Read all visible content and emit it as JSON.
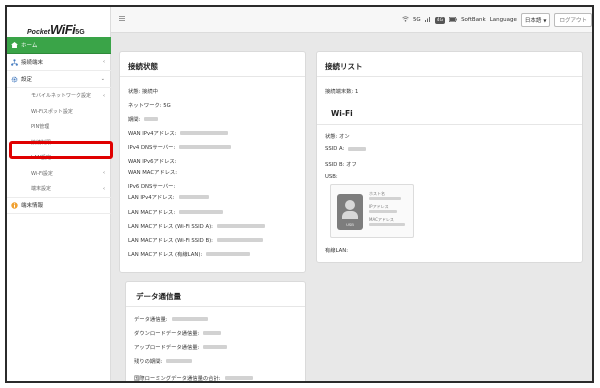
{
  "logo": {
    "pocket": "Pocket",
    "wifi": "WiFi",
    "fiveg": "5G"
  },
  "sidebar": {
    "items": [
      {
        "label": "ホーム",
        "icon": "home-icon"
      },
      {
        "label": "接続端末",
        "icon": "network-icon",
        "chevron": "‹"
      },
      {
        "label": "設定",
        "icon": "gear-icon",
        "chevron": "⌄"
      },
      {
        "label": "モバイルネットワーク設定",
        "chevron": "‹"
      },
      {
        "label": "Wi-Fiスポット設定"
      },
      {
        "label": "PIN管理"
      },
      {
        "label": "接続制限"
      },
      {
        "label": "LAN設定",
        "chevron": "‹"
      },
      {
        "label": "Wi-Fi設定",
        "chevron": "‹"
      },
      {
        "label": "端末設定",
        "chevron": "‹"
      },
      {
        "label": "端末情報",
        "icon": "info-icon"
      }
    ]
  },
  "topbar": {
    "signal": "5G",
    "network_badge": "4G",
    "carrier": "SoftBank",
    "language_label": "Language",
    "language_value": "日本語",
    "logout": "ログアウト"
  },
  "connection_status": {
    "title": "接続状態",
    "rows": [
      {
        "label": "状態: 接続中"
      },
      {
        "label": "ネットワーク: 5G"
      },
      {
        "label": "期間:"
      },
      {
        "label": "WAN IPv4アドレス:"
      },
      {
        "label": "IPv4 DNSサーバー:"
      },
      {
        "label": "WAN IPv6アドレス:"
      },
      {
        "label": "WAN MACアドレス:"
      },
      {
        "label": "IPv6 DNSサーバー:"
      },
      {
        "label": "LAN IPv4アドレス:"
      },
      {
        "label": "LAN MACアドレス:"
      },
      {
        "label": "LAN MACアドレス (Wi-Fi SSID A):"
      },
      {
        "label": "LAN MACアドレス (Wi-Fi SSID B):"
      },
      {
        "label": "LAN MACアドレス (有線LAN):"
      }
    ]
  },
  "connection_list": {
    "title": "接続リスト",
    "count": "接続端末数: 1"
  },
  "wifi": {
    "title": "Wi-Fi",
    "status": "状態: オン",
    "ssid_a": "SSID A:",
    "ssid_b": "SSID B: オフ",
    "usb": "USB:",
    "usb_icon_label": "USB",
    "device_lines": [
      "ホスト名",
      "IPアドレス",
      "MACアドレス"
    ],
    "wired_lan": "有線LAN:"
  },
  "data_usage": {
    "title": "データ通信量",
    "rows": [
      {
        "label": "データ通信量:"
      },
      {
        "label": "ダウンロードデータ通信量:"
      },
      {
        "label": "アップロードデータ通信量:"
      },
      {
        "label": "残りの期間:"
      },
      {
        "label": "国際ローミングデータ通信量の合計:"
      }
    ]
  }
}
